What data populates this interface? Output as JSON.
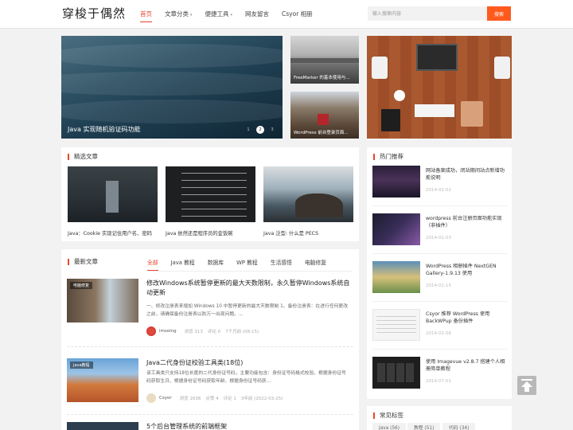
{
  "site": {
    "logo": "穿梭于偶然"
  },
  "nav": [
    {
      "label": "首页",
      "active": true
    },
    {
      "label": "文章分类",
      "caret": "▾"
    },
    {
      "label": "便捷工具",
      "caret": "▾"
    },
    {
      "label": "网友留言"
    },
    {
      "label": "Csyor 相册"
    }
  ],
  "search": {
    "placeholder": "输入搜索内容",
    "button": "搜索"
  },
  "hero": {
    "main_caption": "Java 实现随机验证码功能",
    "dots": [
      "1",
      "2",
      "3"
    ],
    "side1_caption": "FreeMarker 的基本使用与...",
    "side2_caption": "WordPress 前台登录页面..."
  },
  "featured": {
    "title": "精选文章",
    "items": [
      {
        "caption": "Java：Cookie 实现记住用户名、密码"
      },
      {
        "caption": "Java 依然还是程序员的金饭碗"
      },
      {
        "caption": "Java 泛型: 什么是 PECS"
      }
    ]
  },
  "latest": {
    "title": "最新文章",
    "tabs": [
      "全部",
      "Java 教程",
      "数据库",
      "WP 教程",
      "生活感悟",
      "电脑修复"
    ],
    "posts": [
      {
        "tag": "电脑修复",
        "title": "修改Windows系统暂停更新的最大天数限制，永久暂停Windows系统自动更新",
        "excerpt": "一、修改注册表来增加 Windows 10 中暂停更新的最大天数限制 1、备份注册表：在进行任何更改之前，请确保备份注册表以防万一出现问题。...",
        "author": "imsoing",
        "views": "浏览 313",
        "comments": "评论 0",
        "date": "7个月前 (08-15)"
      },
      {
        "tag": "Java教程",
        "title": "Java二代身份证校验工具类(18位)",
        "excerpt": "该工具类只支持18位长度的二代身份证号码，主要功能包含：身份证号码格式校验、根据身份证号码获取生日、根据身份证号码获取年龄、根据身份证号码获...",
        "author": "Csyor",
        "views": "浏览 1636",
        "likes": "点赞 4",
        "comments": "评论 1",
        "date": "3年前 (2022-03-25)"
      },
      {
        "title": "5个后台管理系统的前端框架"
      }
    ]
  },
  "hot": {
    "title": "热门推荐",
    "items": [
      {
        "title": "网站备案成功，闭站期间站点新增功能说明",
        "date": "2014-01-02"
      },
      {
        "title": "wordpress 前台注册页面功能实现（非插件）",
        "date": "2014-01-03"
      },
      {
        "title": "WordPress 相册插件 NextGEN Gallery-1.9.13 使用",
        "date": "2014-01-15"
      },
      {
        "title": "Csyor 推荐 WordPress 使用 BackWPup 备份插件",
        "date": "2014-01-06"
      },
      {
        "title": "使用 Imagevue v2.8.7 搭建个人相册简单教程",
        "date": "2014-07-01"
      }
    ]
  },
  "tags": {
    "title": "常见标签",
    "items": [
      "Java (56)",
      "教程 (51)",
      "代码 (34)"
    ]
  }
}
